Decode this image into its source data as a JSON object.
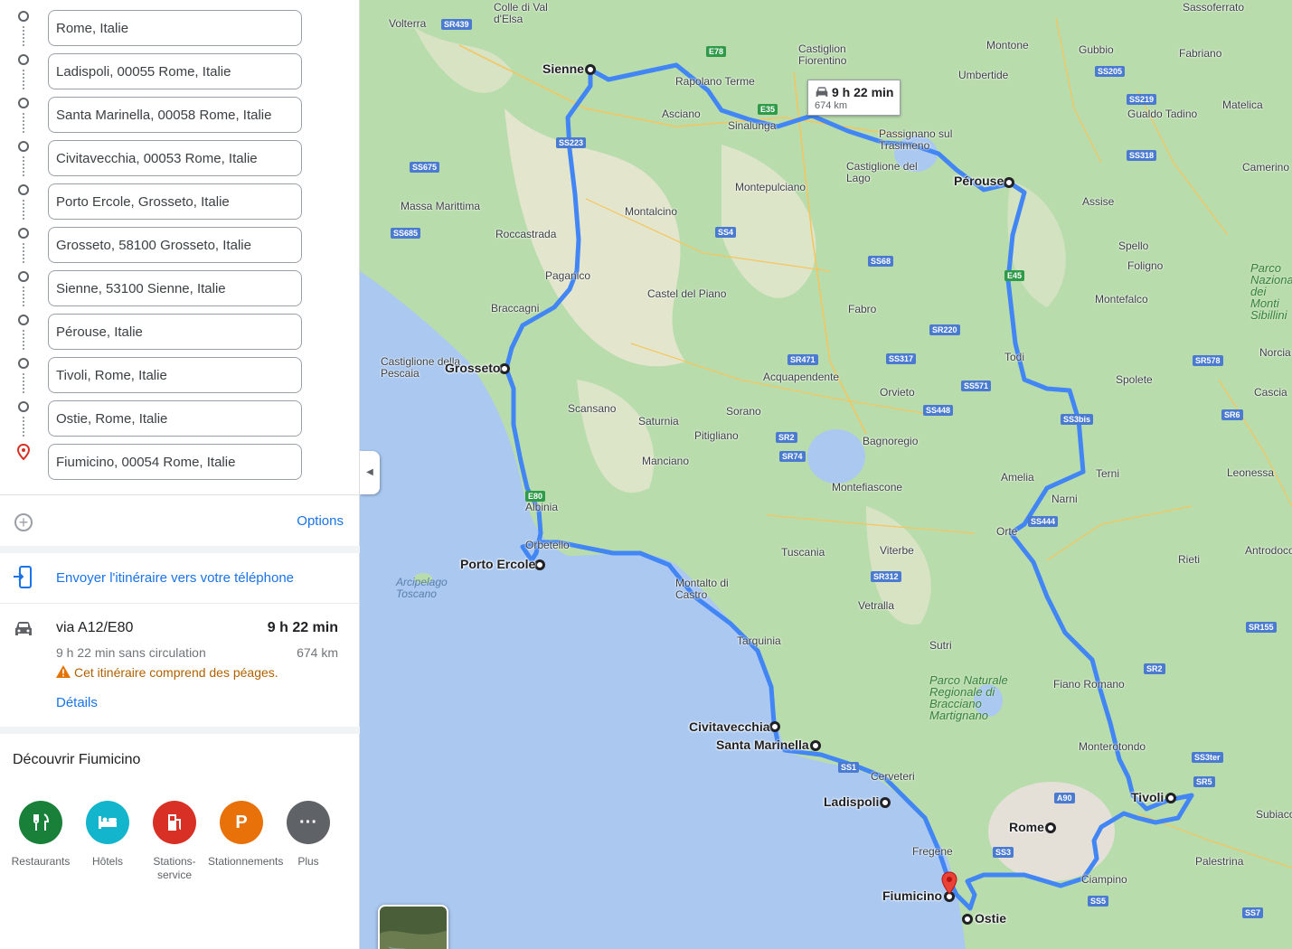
{
  "waypoints": [
    {
      "value": "Rome, Italie",
      "type": "dot"
    },
    {
      "value": "Ladispoli, 00055 Rome, Italie",
      "type": "dot"
    },
    {
      "value": "Santa Marinella, 00058 Rome, Italie",
      "type": "dot"
    },
    {
      "value": "Civitavecchia, 00053 Rome, Italie",
      "type": "dot"
    },
    {
      "value": "Porto Ercole, Grosseto, Italie",
      "type": "dot"
    },
    {
      "value": "Grosseto, 58100 Grosseto, Italie",
      "type": "dot"
    },
    {
      "value": "Sienne, 53100 Sienne, Italie",
      "type": "dot"
    },
    {
      "value": "Pérouse, Italie",
      "type": "dot"
    },
    {
      "value": "Tivoli, Rome, Italie",
      "type": "dot"
    },
    {
      "value": "Ostie, Rome, Italie",
      "type": "dot"
    },
    {
      "value": "Fiumicino, 00054 Rome, Italie",
      "type": "pin"
    }
  ],
  "add_stop": {
    "icon": "add-circle-icon"
  },
  "options_label": "Options",
  "send_to_phone": {
    "label": "Envoyer l'itinéraire vers votre téléphone",
    "icon": "send-to-phone-icon"
  },
  "route": {
    "icon": "car-icon",
    "via": "via A12/E80",
    "duration": "9 h 22 min",
    "no_traffic": "9 h 22 min sans circulation",
    "distance": "674 km",
    "warning": "Cet itinéraire comprend des péages.",
    "warning_icon": "warning-icon",
    "details": "Détails"
  },
  "discover": {
    "title": "Découvrir Fiumicino",
    "categories": [
      {
        "label": "Restaurants",
        "icon": "restaurant-icon",
        "color": "#188038"
      },
      {
        "label": "Hôtels",
        "icon": "hotel-icon",
        "color": "#12b5cb"
      },
      {
        "label": "Stations-service",
        "icon": "gas-station-icon",
        "color": "#d93025"
      },
      {
        "label": "Stationnements",
        "icon": "parking-icon",
        "color": "#e8710a",
        "glyph": "P"
      },
      {
        "label": "Plus",
        "icon": "more-icon",
        "color": "#5f6368",
        "glyph": "···"
      }
    ]
  },
  "map": {
    "route_color": "#4285f4",
    "duration_callout": {
      "duration": "9 h 22 min",
      "distance": "674 km"
    },
    "stop_labels": {
      "sienne": "Sienne",
      "perouse": "Pérouse",
      "grosseto": "Grosseto",
      "porto_ercole": "Porto Ercole",
      "civitavecchia": "Civitavecchia",
      "santa_marinella": "Santa Marinella",
      "ladispoli": "Ladispoli",
      "rome": "Rome",
      "tivoli": "Tivoli",
      "fiumicino": "Fiumicino",
      "ostie": "Ostie"
    },
    "places": [
      "Colle di Val d'Elsa",
      "Volterra",
      "Sassoferrato",
      "Montone",
      "Gubbio",
      "Fabriano",
      "Umbertide",
      "Castiglion Fiorentino",
      "Rapolano Terme",
      "Asciano",
      "Sinalunga",
      "Passignano sul Trasimeno",
      "Gualdo Tadino",
      "Matelica",
      "Camerino",
      "Castiglione del Lago",
      "Montepulciano",
      "Assise",
      "Massa Marittima",
      "Montalcino",
      "Roccastrada",
      "Spello",
      "Foligno",
      "Paganico",
      "Montefalco",
      "Castel del Piano",
      "Braccagni",
      "Fabro",
      "Castiglione della Pescaia",
      "Todi",
      "Acquapendente",
      "Orvieto",
      "Spolete",
      "Cascia",
      "Scansano",
      "Saturnia",
      "Sorano",
      "Bagnoregio",
      "Pitigliano",
      "Terni",
      "Manciano",
      "Montefiascone",
      "Amelia",
      "Leonessa",
      "Albinia",
      "Narni",
      "Orbetello",
      "Orte",
      "Tuscania",
      "Viterbe",
      "Rieti",
      "Montalto di Castro",
      "Vetralla",
      "Tarquinia",
      "Sutri",
      "Fiano Romano",
      "Monterotondo",
      "Cerveteri",
      "Fregene",
      "Ciampino",
      "Palestrina",
      "Subiaco",
      "Antrodoco",
      "Norcia"
    ],
    "water_labels": [
      "Arcipelago Toscano"
    ],
    "park_labels": [
      "Parco Naturale Regionale di Bracciano Martignano",
      "Parco Nazionale dei Monti Sibillini"
    ],
    "road_shields": [
      "E78",
      "E35",
      "SS223",
      "E80",
      "SS1",
      "E45",
      "SS3bis",
      "SS3",
      "A90",
      "SS4",
      "SR2",
      "SR74",
      "SR312",
      "SS675",
      "SR439",
      "SS68",
      "SR220",
      "SS317",
      "SS571",
      "SS448",
      "SS205",
      "SS219",
      "SS318",
      "SS444",
      "SS3ter",
      "SR5",
      "SS5",
      "SS7",
      "SR155",
      "SR6",
      "SR578",
      "SR471",
      "SS685",
      "SR2",
      "SR439",
      "SS4"
    ]
  },
  "collapse_icon": "collapse-panel-icon"
}
